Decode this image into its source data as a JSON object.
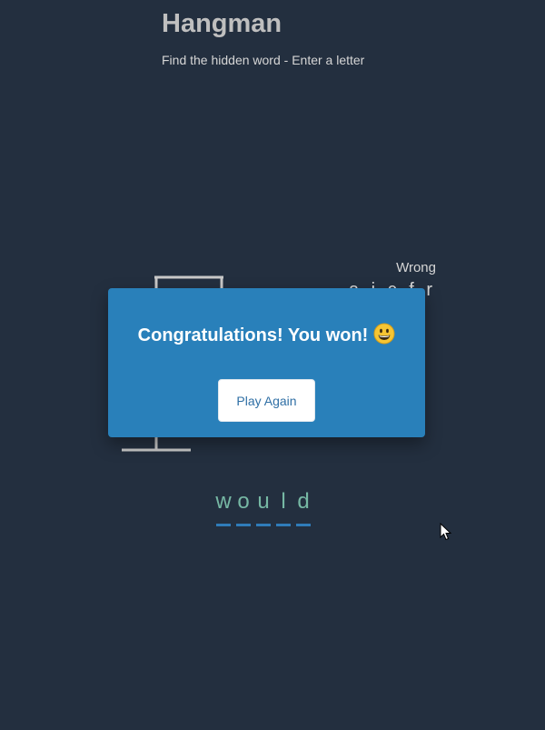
{
  "header": {
    "title": "Hangman",
    "subtitle": "Find the hidden word - Enter a letter"
  },
  "wrong": {
    "label": "Wrong",
    "letters": "a,i,c,f,r"
  },
  "word": {
    "letters": [
      "w",
      "o",
      "u",
      "l",
      "d"
    ]
  },
  "popup": {
    "message": "Congratulations! You won!",
    "emoji": "grinning-face-icon",
    "button_label": "Play Again"
  },
  "colors": {
    "background": "#232f3f",
    "popup": "#2980ba",
    "word_letters": "#76b8a4",
    "underline": "#2f7cb9",
    "button_text": "#2f6fa5"
  },
  "icons": {
    "cursor": "mouse-pointer-icon"
  }
}
